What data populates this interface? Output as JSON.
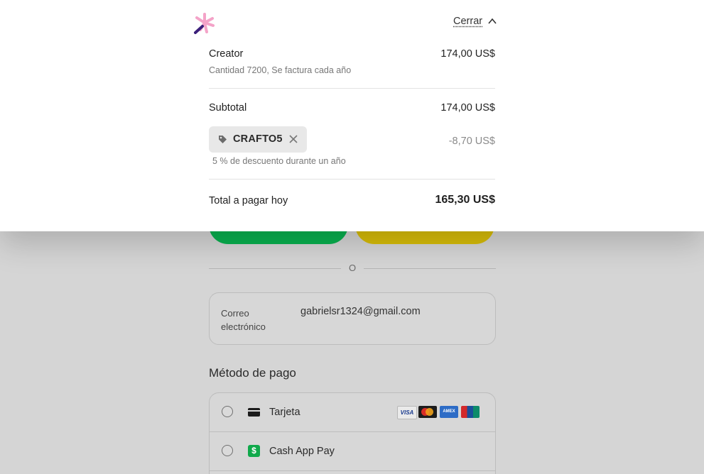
{
  "summary": {
    "close_label": "Cerrar",
    "item": {
      "name": "Creator",
      "price": "174,00 US$",
      "detail": "Cantidad 7200, Se factura cada año"
    },
    "subtotal_label": "Subtotal",
    "subtotal_value": "174,00 US$",
    "promo": {
      "code": "CRAFTO5",
      "discount_value": "-8,70 US$",
      "description": "5 % de descuento durante un año"
    },
    "total_label": "Total a pagar hoy",
    "total_value": "165,30 US$"
  },
  "checkout": {
    "divider_text": "O",
    "email_label": "Correo electrónico",
    "email_value": "gabrielsr1324@gmail.com",
    "payment_method_title": "Método de pago",
    "methods": [
      {
        "label": "Tarjeta",
        "icon": "card-icon"
      },
      {
        "label": "Cash App Pay",
        "icon": "cash-app-icon"
      }
    ],
    "card_brands": [
      "VISA",
      "Mastercard",
      "AMEX",
      "UnionPay"
    ]
  },
  "colors": {
    "express_green": "#08b14f",
    "express_yellow": "#d8bd08",
    "overlay_gray": "#d5d5d5",
    "panel_white": "#ffffff"
  }
}
